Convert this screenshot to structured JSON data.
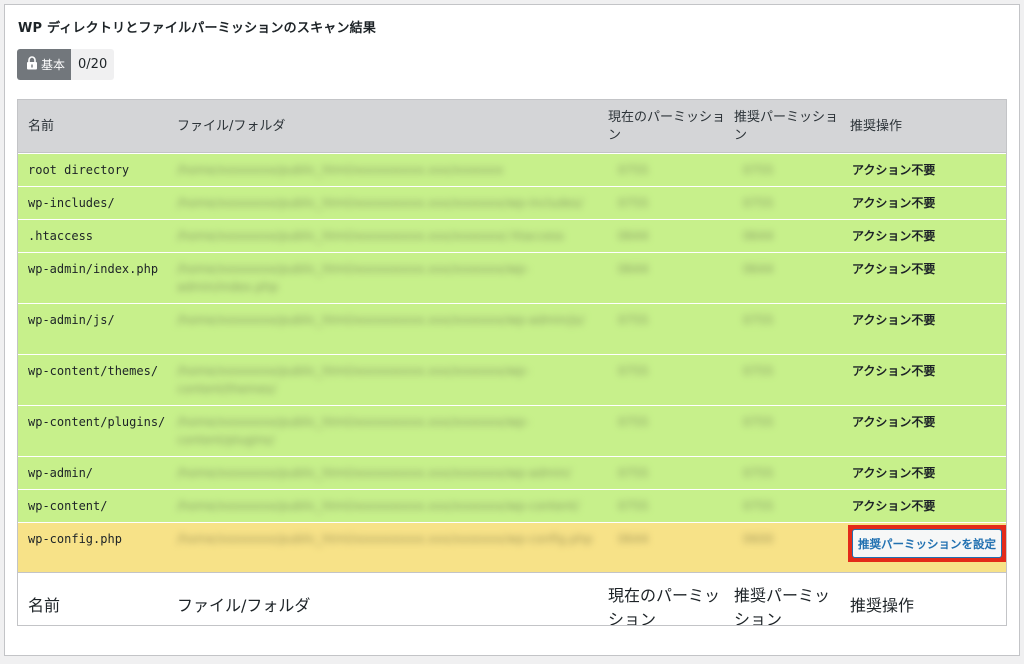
{
  "title": "WP ディレクトリとファイルパーミッションのスキャン結果",
  "status": {
    "badge_label": "基本",
    "count": "0/20"
  },
  "columns": {
    "name": "名前",
    "path": "ファイル/フォルダ",
    "current": "現在のパーミッション",
    "recommended": "推奨パーミッション",
    "action": "推奨操作"
  },
  "rows": [
    {
      "name": "root directory",
      "blur_path": "/home/xxxxxxxx/public_html/xxxxxxxxxx.xxx/xxxxxxx",
      "blur_cur": "0755",
      "blur_rec": "0755",
      "action": "アクション不要",
      "state": "ok"
    },
    {
      "name": "wp-includes/",
      "blur_path": "/home/xxxxxxxx/public_html/xxxxxxxxxx.xxx/xxxxxxx/wp-includes/",
      "blur_cur": "0755",
      "blur_rec": "0755",
      "action": "アクション不要",
      "state": "ok"
    },
    {
      "name": ".htaccess",
      "blur_path": "/home/xxxxxxxx/public_html/xxxxxxxxxx.xxx/xxxxxxx/.htaccess",
      "blur_cur": "0644",
      "blur_rec": "0644",
      "action": "アクション不要",
      "state": "ok"
    },
    {
      "name": "wp-admin/index.php",
      "blur_path": "/home/xxxxxxxx/public_html/xxxxxxxxxx.xxx/xxxxxxx/wp-admin/index.php",
      "blur_cur": "0644",
      "blur_rec": "0644",
      "action": "アクション不要",
      "state": "ok"
    },
    {
      "name": "wp-admin/js/",
      "blur_path": "/home/xxxxxxxx/public_html/xxxxxxxxxx.xxx/xxxxxxx/wp-admin/js/",
      "blur_cur": "0755",
      "blur_rec": "0755",
      "action": "アクション不要",
      "state": "ok"
    },
    {
      "name": "wp-content/themes/",
      "blur_path": "/home/xxxxxxxx/public_html/xxxxxxxxxx.xxx/xxxxxxx/wp-content/themes/",
      "blur_cur": "0755",
      "blur_rec": "0755",
      "action": "アクション不要",
      "state": "ok"
    },
    {
      "name": "wp-content/plugins/",
      "blur_path": "/home/xxxxxxxx/public_html/xxxxxxxxxx.xxx/xxxxxxx/wp-content/plugins/",
      "blur_cur": "0755",
      "blur_rec": "0755",
      "action": "アクション不要",
      "state": "ok"
    },
    {
      "name": "wp-admin/",
      "blur_path": "/home/xxxxxxxx/public_html/xxxxxxxxxx.xxx/xxxxxxx/wp-admin/",
      "blur_cur": "0755",
      "blur_rec": "0755",
      "action": "アクション不要",
      "state": "ok"
    },
    {
      "name": "wp-content/",
      "blur_path": "/home/xxxxxxxx/public_html/xxxxxxxxxx.xxx/xxxxxxx/wp-content/",
      "blur_cur": "0755",
      "blur_rec": "0755",
      "action": "アクション不要",
      "state": "ok"
    },
    {
      "name": "wp-config.php",
      "blur_path": "/home/xxxxxxxx/public_html/xxxxxxxxxx.xxx/xxxxxxx/wp-config.php",
      "blur_cur": "0644",
      "blur_rec": "0600",
      "action": "推奨パーミッションを設定",
      "state": "warn"
    }
  ],
  "colors": {
    "ok_row": "#c7f08b",
    "warn_row": "#f7e288",
    "highlight": "#e32b1a",
    "button_text": "#2271b1"
  }
}
